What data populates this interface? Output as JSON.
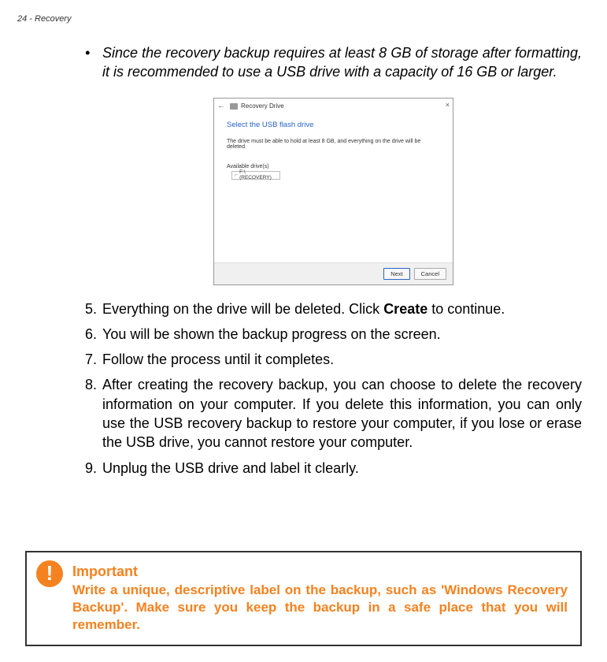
{
  "page_header": "24 - Recovery",
  "bullet": {
    "dot": "•",
    "text": "Since the recovery backup requires at least 8  GB of storage after formatting, it is recommended to use a USB drive with a capacity of 16  GB or larger."
  },
  "dialog": {
    "back": "←",
    "title": "Recovery Drive",
    "close": "×",
    "heading": "Select the USB flash drive",
    "instruction": "The drive must be able to hold at least 8 GB, and everything on the drive will be deleted.",
    "available_label": "Available drive(s)",
    "tree_symbol": "⌐",
    "list_item": "F:\\ (RECOVERY)",
    "btn_next": "Next",
    "btn_cancel": "Cancel"
  },
  "steps": {
    "5": {
      "num": "5.",
      "prefix": "Everything on the drive will be deleted. Click ",
      "bold": "Create",
      "suffix": " to continue."
    },
    "6": {
      "num": "6.",
      "text": "You will be shown the backup progress on the screen."
    },
    "7": {
      "num": "7.",
      "text": "Follow the process until it completes."
    },
    "8": {
      "num": "8.",
      "text": "After creating the recovery backup, you can choose to delete the recovery information on your computer. If you delete this information, you can only use the USB recovery backup to restore your computer, if you lose or erase the USB drive, you cannot restore your computer."
    },
    "9": {
      "num": "9.",
      "text": "Unplug the USB drive and label it clearly."
    }
  },
  "important": {
    "icon": "!",
    "heading": "Important",
    "text": "Write a unique, descriptive label on the backup, such as 'Windows Recovery Backup'. Make sure you keep the backup in a safe place that you will remember."
  }
}
